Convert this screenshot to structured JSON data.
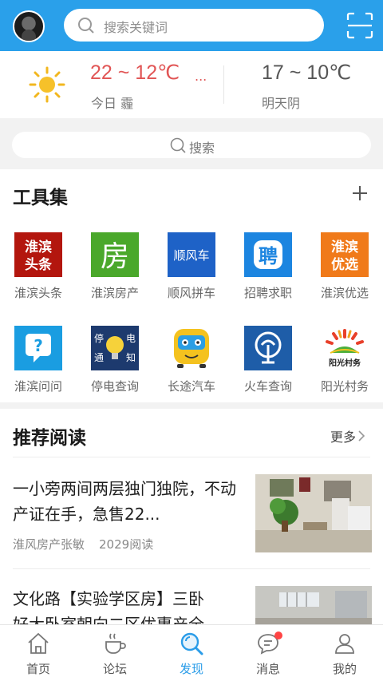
{
  "header": {
    "search_placeholder": "搜索关键词"
  },
  "weather": {
    "today_range": "22 ~ 12℃",
    "today_more": "...",
    "today_label": "今日 霾",
    "tomorrow_range": "17 ~ 10℃",
    "tomorrow_label": "明天阴"
  },
  "sub_search": {
    "label": "搜索"
  },
  "tools": {
    "title": "工具集",
    "items": [
      {
        "label": "淮滨头条",
        "icon": "huaibin-headlines-icon",
        "icon_text": [
          "淮滨",
          "头条"
        ],
        "color": "#b3160e"
      },
      {
        "label": "淮滨房产",
        "icon": "house-icon",
        "icon_text": [
          "房"
        ],
        "color": "#4aa82b"
      },
      {
        "label": "顺风拼车",
        "icon": "carpool-icon",
        "icon_text": [
          "顺风车"
        ],
        "color": "#1e62c7"
      },
      {
        "label": "招聘求职",
        "icon": "recruit-icon",
        "icon_text": [
          "聘"
        ],
        "color": "#1c85e0"
      },
      {
        "label": "淮滨优选",
        "icon": "preferred-icon",
        "icon_text": [
          "淮滨",
          "优选"
        ],
        "color": "#f07a1a"
      },
      {
        "label": "淮滨问问",
        "icon": "question-icon",
        "icon_text": [
          "?"
        ],
        "color": "#1a9de1"
      },
      {
        "label": "停电查询",
        "icon": "power-outage-icon",
        "icon_text": [
          "停",
          "电",
          "通",
          "知"
        ],
        "color": "#1d3a6e"
      },
      {
        "label": "长途汽车",
        "icon": "bus-icon",
        "icon_text": [],
        "color": "#f4c21f"
      },
      {
        "label": "火车查询",
        "icon": "train-icon",
        "icon_text": [],
        "color": "#1e5da8"
      },
      {
        "label": "阳光村务",
        "icon": "sunshine-village-icon",
        "icon_text": [
          "阳光村务"
        ],
        "color": "#e8402a"
      }
    ]
  },
  "recommended": {
    "title": "推荐阅读",
    "more_label": "更多",
    "articles": [
      {
        "title": "一小旁两间两层独门独院，不动产证在手，急售22...",
        "author": "淮风房产张敏",
        "reads": "2029阅读"
      },
      {
        "title": "文化路【实验学区房】三卧",
        "title_line2": "好大卧室朝向二区优惠产全"
      }
    ]
  },
  "bottom_nav": {
    "items": [
      {
        "label": "首页",
        "icon": "home-icon"
      },
      {
        "label": "论坛",
        "icon": "coffee-icon"
      },
      {
        "label": "发现",
        "icon": "discover-icon"
      },
      {
        "label": "消息",
        "icon": "message-icon"
      },
      {
        "label": "我的",
        "icon": "profile-icon"
      }
    ],
    "active": "发现",
    "accent": "#2a9ce8"
  }
}
